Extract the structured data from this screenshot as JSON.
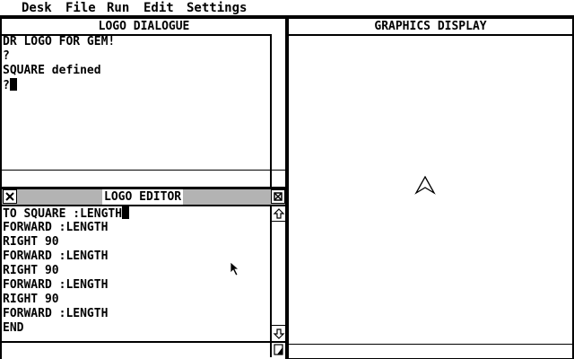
{
  "menu": {
    "items": [
      {
        "label": "Desk"
      },
      {
        "label": "File"
      },
      {
        "label": "Run"
      },
      {
        "label": "Edit"
      },
      {
        "label": "Settings"
      }
    ]
  },
  "dialogue": {
    "title": "LOGO DIALOGUE",
    "lines": [
      "DR LOGO FOR GEM!",
      "?",
      "SQUARE defined",
      "?"
    ]
  },
  "editor": {
    "title": "LOGO EDITOR",
    "close_icon": "close-box-icon",
    "fuller_icon": "fuller-box-icon",
    "lines": [
      "TO SQUARE :LENGTH",
      "FORWARD :LENGTH",
      "RIGHT 90",
      "FORWARD :LENGTH",
      "RIGHT 90",
      "FORWARD :LENGTH",
      "RIGHT 90",
      "FORWARD :LENGTH",
      "END"
    ]
  },
  "graphics": {
    "title": "GRAPHICS DISPLAY",
    "turtle_icon": "turtle-arrow-icon"
  }
}
